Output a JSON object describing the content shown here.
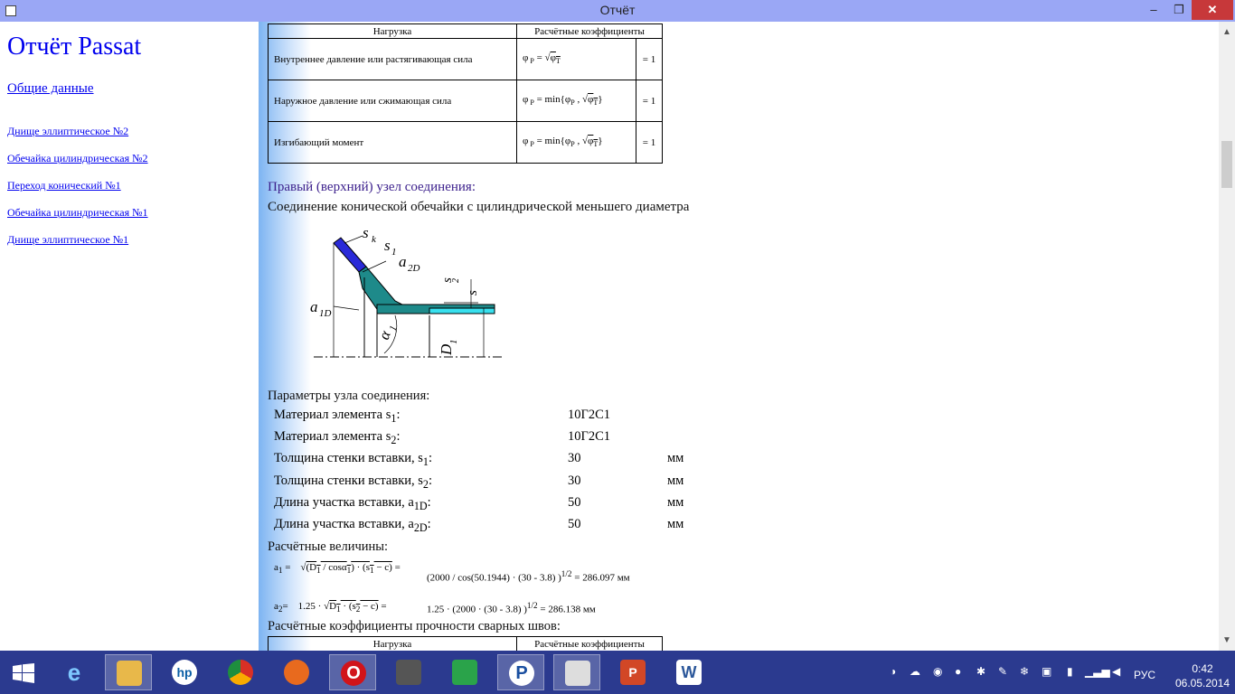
{
  "window": {
    "title": "Отчёт",
    "minimize": "–",
    "maximize": "❐",
    "close": "✕"
  },
  "sidebar": {
    "title": "Отчёт Passat",
    "general": "Общие данные",
    "items": [
      "Днище эллиптическое №2",
      "Обечайка цилиндрическая №2",
      "Переход конический №1",
      "Обечайка цилиндрическая №1",
      "Днище эллиптическое №1"
    ]
  },
  "table1": {
    "header": [
      "Нагрузка",
      "Расчётные коэффициенты"
    ],
    "rows": [
      {
        "load": "Внутреннее давление или растягивающая сила",
        "equals": "= 1"
      },
      {
        "load": "Наружное давление или сжимающая сила",
        "equals": "= 1"
      },
      {
        "load": "Изгибающий момент",
        "equals": "= 1"
      }
    ]
  },
  "section": {
    "heading": "Правый (верхний) узел соединения:",
    "description": "Соединение конической обечайки с цилиндрической меньшего диаметра"
  },
  "figure": {
    "labels": [
      "s",
      "k",
      "s",
      "1",
      "a",
      "2D",
      "s",
      "2",
      "s",
      "a",
      "1D",
      "α",
      "1",
      "D",
      "1"
    ]
  },
  "params": {
    "title": "Параметры узла соединения:",
    "rows": [
      {
        "label": "Материал элемента s",
        "sub": "1",
        "end": ":",
        "value": "10Г2С1",
        "unit": ""
      },
      {
        "label": "Материал элемента s",
        "sub": "2",
        "end": ":",
        "value": "10Г2С1",
        "unit": ""
      },
      {
        "label": "Толщина стенки вставки, s",
        "sub": "1",
        "end": ":",
        "value": "30",
        "unit": "мм"
      },
      {
        "label": "Толщина стенки вставки, s",
        "sub": "2",
        "end": ":",
        "value": "30",
        "unit": "мм"
      },
      {
        "label": "Длина участка вставки, a",
        "sub": "1D",
        "end": ":",
        "value": "50",
        "unit": "мм"
      },
      {
        "label": "Длина участка вставки, a",
        "sub": "2D",
        "end": ":",
        "value": "50",
        "unit": "мм"
      }
    ]
  },
  "calc": {
    "title": "Расчётные величины:",
    "a1_result": "(2000 / cos(50.1944) · (30 - 3.8)  )",
    "a1_value": " = 286.097 мм",
    "a2_result": "1.25 · (2000 · (30 - 3.8)  )",
    "a2_value": " = 286.138 мм",
    "exp": "1/2"
  },
  "table2": {
    "title": "Расчётные коэффициенты прочности сварных швов:",
    "header": [
      "Нагрузка",
      "Расчётные коэффициенты"
    ]
  },
  "taskbar": {
    "lang": "РУС",
    "time": "0:42",
    "date": "06.05.2014"
  }
}
